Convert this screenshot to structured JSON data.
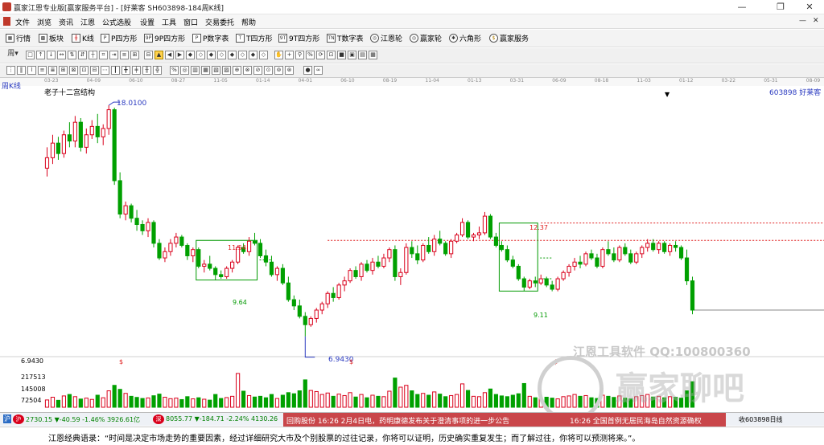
{
  "window": {
    "title": "赢家江恩专业版[赢家服务平台] - [好莱客  SH603898-184周K线]",
    "min_label": "—",
    "max_label": "❐",
    "close_label": "✕"
  },
  "menu": {
    "items": [
      "文件",
      "浏览",
      "资讯",
      "江恩",
      "公式选股",
      "设置",
      "工具",
      "窗口",
      "交易委托",
      "帮助"
    ],
    "right_buttons": [
      "—",
      "✕"
    ]
  },
  "navbar": {
    "items": [
      {
        "label": "行情",
        "icon": "grid-icon"
      },
      {
        "label": "板块",
        "icon": "blocks-icon"
      },
      {
        "label": "K线",
        "icon": "kline-icon"
      },
      {
        "label": "P四方形",
        "icon": "square-icon",
        "badge": "P"
      },
      {
        "label": "9P四方形",
        "icon": "square-icon",
        "badge": "9P"
      },
      {
        "label": "P数字表",
        "icon": "table-icon",
        "badge": "P"
      },
      {
        "label": "T四方形",
        "icon": "square-icon",
        "badge": "T"
      },
      {
        "label": "9T四方形",
        "icon": "square-icon",
        "badge": "9T"
      },
      {
        "label": "T数字表",
        "icon": "table-icon",
        "badge": "TN"
      },
      {
        "label": "江恩轮",
        "icon": "wheel-icon"
      },
      {
        "label": "赢家轮",
        "icon": "wheel-icon"
      },
      {
        "label": "六角形",
        "icon": "hexagon-icon"
      },
      {
        "label": "赢家服务",
        "icon": "dollar-icon"
      }
    ]
  },
  "toolbar": {
    "period_label": "周",
    "tools1": [
      "□",
      "↑",
      "↓",
      "↔",
      "⇅",
      "⇵",
      "┼",
      "⌗",
      "⇥",
      "≡",
      "⊞",
      "⊟",
      "▲",
      "◀",
      "▶",
      "◆",
      "◇",
      "◆",
      "◇",
      "◆",
      "◇",
      "◆",
      "◇",
      "✋",
      "+",
      "⚲",
      "%",
      "⟳",
      "⊡",
      "■",
      "▣",
      "▤",
      "▦"
    ],
    "tools2": [
      "⋮",
      "‖",
      "⌇",
      "≡",
      "≣",
      "⊞",
      "⊠",
      "⊡",
      "⊟",
      "⋯",
      "┃",
      "╋",
      "╪",
      "╫",
      "╬",
      "%",
      "◎",
      "▥",
      "▦",
      "▧",
      "▨",
      "⊕",
      "⊗",
      "⊘",
      "⊙",
      "⊚",
      "⊛",
      "●",
      "∞"
    ]
  },
  "timeaxis": {
    "labels": [
      "03-23",
      "04-09",
      "06-10",
      "08-27",
      "11-05",
      "01-14",
      "04-01",
      "06-10",
      "08-19",
      "11-04",
      "01-13",
      "03-31",
      "06-09",
      "08-18",
      "11-03",
      "01-12",
      "03-22",
      "05-31",
      "08-09"
    ]
  },
  "chart": {
    "period_label": "周K线",
    "indicator_label": "老子十二宫结构",
    "stock_label": "603898  好莱客",
    "price_labels": {
      "high": "18.0100",
      "box1_top": "11.54",
      "box1_bottom": "9.64",
      "low": "6.9430",
      "box2_top": "12.37",
      "box2_bottom": "9.11"
    },
    "volume_axis": [
      "6.9430",
      "217513",
      "145008",
      "72504"
    ],
    "volume_marker": "$",
    "colors": {
      "up": "#d9001b",
      "down": "#00a000",
      "box": "#009900",
      "dash": "#e02020",
      "label_blue": "#2a3ac0"
    }
  },
  "chart_data": {
    "type": "candlestick",
    "title": "老子十二宫结构",
    "symbol": "603898",
    "name": "好莱客",
    "period": "周K线",
    "annotations": {
      "high": 18.01,
      "low": 6.943,
      "resistance_1": 11.54,
      "support_1": 9.64,
      "resistance_2": 12.37,
      "support_2": 9.11
    },
    "ohlc": [
      [
        15.0,
        16.0,
        14.6,
        15.5
      ],
      [
        15.5,
        16.6,
        15.2,
        16.2
      ],
      [
        16.2,
        16.5,
        15.4,
        15.7
      ],
      [
        15.7,
        16.8,
        15.5,
        16.6
      ],
      [
        16.6,
        17.2,
        16.0,
        16.3
      ],
      [
        16.3,
        17.5,
        16.0,
        17.2
      ],
      [
        17.2,
        17.4,
        15.8,
        16.0
      ],
      [
        16.0,
        16.9,
        15.7,
        16.6
      ],
      [
        16.6,
        17.3,
        16.4,
        17.0
      ],
      [
        17.0,
        17.6,
        16.2,
        16.5
      ],
      [
        16.5,
        17.1,
        16.1,
        16.9
      ],
      [
        16.9,
        18.01,
        16.6,
        17.8
      ],
      [
        17.8,
        17.9,
        14.2,
        14.4
      ],
      [
        14.4,
        14.8,
        12.6,
        12.8
      ],
      [
        12.8,
        13.4,
        12.5,
        13.2
      ],
      [
        13.2,
        13.3,
        12.4,
        12.6
      ],
      [
        12.6,
        13.0,
        12.0,
        12.3
      ],
      [
        12.3,
        12.5,
        11.8,
        12.0
      ],
      [
        12.0,
        12.6,
        11.7,
        12.4
      ],
      [
        12.4,
        12.5,
        11.2,
        11.4
      ],
      [
        11.4,
        11.6,
        10.6,
        10.7
      ],
      [
        10.7,
        11.2,
        10.5,
        11.0
      ],
      [
        11.0,
        11.6,
        10.8,
        11.4
      ],
      [
        11.4,
        11.9,
        11.2,
        11.7
      ],
      [
        11.7,
        11.8,
        11.2,
        11.3
      ],
      [
        11.3,
        11.4,
        10.6,
        10.8
      ],
      [
        10.8,
        11.2,
        10.5,
        11.1
      ],
      [
        11.1,
        11.2,
        10.2,
        10.3
      ],
      [
        10.3,
        10.6,
        10.0,
        10.4
      ],
      [
        10.4,
        10.8,
        10.1,
        10.2
      ],
      [
        10.2,
        10.3,
        9.64,
        9.9
      ],
      [
        9.9,
        10.1,
        9.7,
        9.8
      ],
      [
        9.8,
        10.3,
        9.7,
        10.2
      ],
      [
        10.2,
        10.6,
        10.0,
        10.5
      ],
      [
        10.5,
        11.3,
        10.4,
        11.2
      ],
      [
        11.2,
        11.4,
        10.9,
        11.0
      ],
      [
        11.0,
        11.7,
        10.8,
        11.5
      ],
      [
        11.5,
        11.9,
        11.3,
        11.4
      ],
      [
        11.4,
        11.6,
        10.7,
        10.8
      ],
      [
        10.8,
        11.1,
        10.3,
        10.5
      ],
      [
        10.5,
        10.8,
        9.8,
        9.9
      ],
      [
        9.9,
        10.3,
        9.6,
        10.2
      ],
      [
        10.2,
        10.4,
        9.4,
        9.5
      ],
      [
        9.5,
        9.8,
        8.6,
        8.7
      ],
      [
        8.7,
        8.9,
        8.2,
        8.4
      ],
      [
        8.4,
        8.7,
        7.8,
        7.9
      ],
      [
        7.9,
        8.1,
        6.943,
        7.5
      ],
      [
        7.5,
        7.9,
        7.4,
        7.8
      ],
      [
        7.8,
        8.3,
        7.6,
        8.2
      ],
      [
        8.2,
        8.6,
        8.0,
        8.5
      ],
      [
        8.5,
        9.1,
        8.3,
        9.0
      ],
      [
        9.0,
        9.3,
        8.6,
        8.8
      ],
      [
        8.8,
        9.5,
        8.7,
        9.4
      ],
      [
        9.4,
        9.8,
        9.1,
        9.6
      ],
      [
        9.6,
        10.2,
        9.5,
        10.1
      ],
      [
        10.1,
        10.3,
        9.7,
        9.8
      ],
      [
        9.8,
        10.5,
        9.6,
        10.4
      ],
      [
        10.4,
        10.6,
        10.0,
        10.1
      ],
      [
        10.1,
        10.7,
        9.9,
        10.5
      ],
      [
        10.5,
        10.8,
        10.2,
        10.3
      ],
      [
        10.3,
        10.9,
        10.2,
        10.7
      ],
      [
        10.7,
        11.2,
        10.5,
        11.1
      ],
      [
        11.1,
        11.3,
        9.6,
        9.8
      ],
      [
        9.8,
        10.2,
        9.4,
        10.0
      ],
      [
        10.0,
        11.4,
        9.9,
        11.2
      ],
      [
        11.2,
        11.5,
        10.7,
        10.9
      ],
      [
        10.9,
        11.3,
        10.4,
        10.6
      ],
      [
        10.6,
        11.4,
        10.5,
        11.3
      ],
      [
        11.3,
        11.7,
        10.9,
        11.0
      ],
      [
        11.0,
        11.8,
        10.8,
        11.6
      ],
      [
        11.6,
        12.0,
        11.3,
        11.4
      ],
      [
        11.4,
        11.5,
        10.8,
        10.9
      ],
      [
        10.9,
        11.6,
        10.7,
        11.5
      ],
      [
        11.5,
        11.9,
        11.4,
        11.8
      ],
      [
        11.8,
        12.6,
        11.7,
        12.4
      ],
      [
        12.4,
        12.5,
        11.6,
        11.7
      ],
      [
        11.7,
        11.9,
        11.5,
        11.8
      ],
      [
        11.8,
        12.2,
        11.6,
        11.9
      ],
      [
        11.9,
        12.9,
        11.8,
        12.7
      ],
      [
        12.7,
        12.8,
        11.6,
        11.7
      ],
      [
        11.7,
        11.9,
        11.2,
        11.3
      ],
      [
        11.3,
        11.5,
        11.0,
        11.1
      ],
      [
        11.1,
        11.3,
        10.5,
        10.6
      ],
      [
        10.6,
        10.8,
        10.2,
        10.3
      ],
      [
        10.3,
        10.4,
        9.6,
        9.7
      ],
      [
        9.7,
        9.8,
        9.11,
        9.3
      ],
      [
        9.3,
        9.7,
        9.2,
        9.6
      ],
      [
        9.6,
        9.8,
        9.3,
        9.5
      ],
      [
        9.5,
        9.9,
        9.4,
        9.7
      ],
      [
        9.7,
        9.8,
        9.3,
        9.4
      ],
      [
        9.4,
        9.6,
        9.1,
        9.2
      ],
      [
        9.2,
        9.8,
        9.1,
        9.7
      ],
      [
        9.7,
        10.1,
        9.6,
        10.0
      ],
      [
        10.0,
        10.4,
        9.8,
        10.3
      ],
      [
        10.3,
        10.7,
        10.1,
        10.5
      ],
      [
        10.5,
        10.8,
        10.2,
        10.4
      ],
      [
        10.4,
        11.0,
        10.3,
        10.9
      ],
      [
        10.9,
        11.1,
        10.6,
        10.7
      ],
      [
        10.7,
        10.9,
        10.2,
        10.3
      ],
      [
        10.3,
        11.2,
        10.2,
        11.1
      ],
      [
        11.1,
        11.5,
        10.8,
        10.9
      ],
      [
        10.9,
        11.2,
        10.5,
        10.6
      ],
      [
        10.6,
        11.3,
        10.5,
        11.2
      ],
      [
        11.2,
        11.4,
        10.8,
        10.9
      ],
      [
        10.9,
        11.1,
        10.4,
        10.5
      ],
      [
        10.5,
        11.0,
        10.4,
        10.9
      ],
      [
        10.9,
        11.3,
        10.7,
        11.2
      ],
      [
        11.2,
        11.6,
        11.0,
        11.4
      ],
      [
        11.4,
        11.6,
        11.0,
        11.1
      ],
      [
        11.1,
        11.5,
        10.9,
        11.4
      ],
      [
        11.4,
        11.5,
        10.9,
        11.0
      ],
      [
        11.0,
        11.4,
        10.8,
        11.3
      ],
      [
        11.3,
        11.5,
        11.0,
        11.2
      ],
      [
        11.2,
        11.3,
        10.6,
        10.7
      ],
      [
        10.7,
        11.1,
        9.4,
        9.6
      ],
      [
        9.6,
        9.8,
        8.0,
        8.2
      ]
    ],
    "volume": [
      40000,
      55000,
      38000,
      62000,
      70000,
      58000,
      45000,
      50000,
      43000,
      66000,
      52000,
      90000,
      120000,
      98000,
      76000,
      60000,
      54000,
      48000,
      51000,
      63000,
      72000,
      55000,
      47000,
      50000,
      42000,
      58000,
      46000,
      52000,
      44000,
      39000,
      70000,
      48000,
      53000,
      60000,
      185000,
      88000,
      64000,
      56000,
      60000,
      52000,
      70000,
      48000,
      66000,
      80000,
      74000,
      90000,
      150000,
      92000,
      86000,
      70000,
      78000,
      60000,
      72000,
      64000,
      80000,
      56000,
      70000,
      52000,
      66000,
      60000,
      58000,
      88000,
      160000,
      110000,
      120000,
      90000,
      70000,
      76000,
      66000,
      84000,
      72000,
      58000,
      64000,
      70000,
      128000,
      92000,
      60000,
      58000,
      80000,
      100000,
      70000,
      62000,
      58000,
      66000,
      74000,
      130000,
      60000,
      52000,
      48000,
      55000,
      50000,
      46000,
      58000,
      62000,
      70000,
      60000,
      64000,
      52000,
      48000,
      66000,
      60000,
      54000,
      62000,
      50000,
      46000,
      58000,
      64000,
      70000,
      56000,
      60000,
      52000,
      58000,
      55000,
      50000,
      90000,
      140000
    ]
  },
  "watermark": {
    "software": "江恩工具软件   QQ:100800360",
    "brand": "赢家聊吧"
  },
  "statusbar": {
    "sh_marker": "沪",
    "sh": "2730.15  ▼-40.59  -1.46%  3926.61亿",
    "sz_marker": "深",
    "sz": "8055.77  ▼-184.71  -2.24%  4130.26",
    "ticker_news": "回购股份  16:26  2月4日电，药明康德发布关于澄清事项的进一步公告",
    "ticker_news2": "16:26  全国首例无居民海岛自然资源确权",
    "right": "收603898日线"
  },
  "quote": {
    "text": "江恩经典语录：“时间是决定市场走势的重要因素，经过详细研究大市及个别股票的过往记录，你将可以证明，历史确实重复发生；而了解过往，你将可以预测将来。”。"
  }
}
